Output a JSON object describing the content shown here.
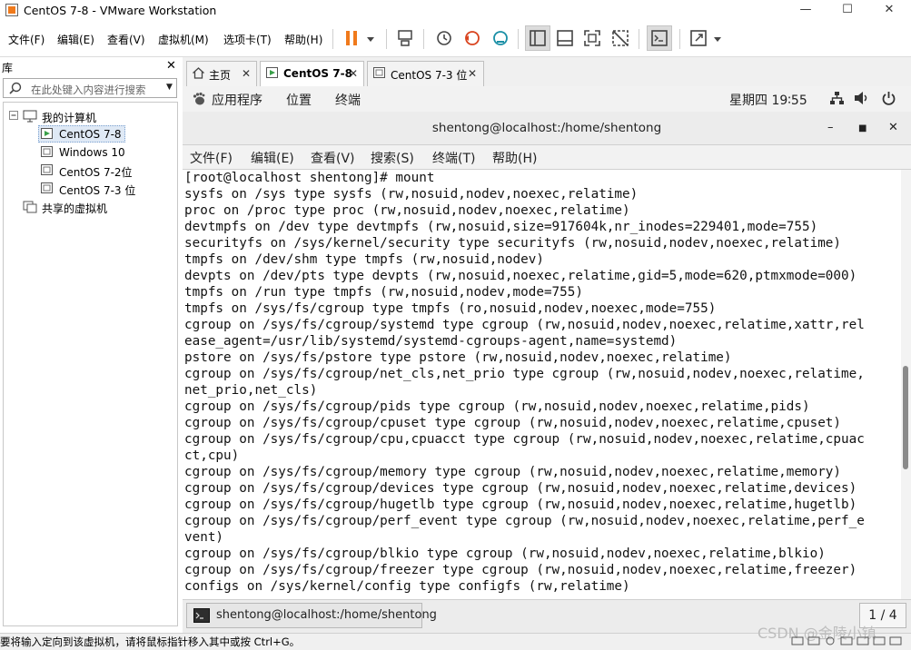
{
  "window": {
    "title": "CentOS 7-8 - VMware Workstation",
    "controls": [
      "—",
      "☐",
      "✕"
    ]
  },
  "menubar": {
    "items": [
      "文件(F)",
      "编辑(E)",
      "查看(V)",
      "虚拟机(M)",
      "选项卡(T)",
      "帮助(H)"
    ]
  },
  "library": {
    "title": "库",
    "close": "✕",
    "search_placeholder": "在此处键入内容进行搜索",
    "tree": {
      "root": "我的计算机",
      "vms": [
        "CentOS 7-8",
        "Windows 10",
        "CentOS 7-2位",
        "CentOS 7-3 位"
      ],
      "shared": "共享的虚拟机"
    }
  },
  "tabs": [
    {
      "label": "主页",
      "closable": true
    },
    {
      "label": "CentOS 7-8",
      "closable": true,
      "active": true
    },
    {
      "label": "CentOS 7-3 位",
      "closable": true
    }
  ],
  "gnome": {
    "applications": "应用程序",
    "places": "位置",
    "terminal": "终端",
    "clock": "星期四 19∶55"
  },
  "terminal": {
    "title": "shentong@localhost:/home/shentong",
    "menu": [
      "文件(F)",
      "编辑(E)",
      "查看(V)",
      "搜索(S)",
      "终端(T)",
      "帮助(H)"
    ],
    "lines": [
      "[root@localhost shentong]# mount",
      "sysfs on /sys type sysfs (rw,nosuid,nodev,noexec,relatime)",
      "proc on /proc type proc (rw,nosuid,nodev,noexec,relatime)",
      "devtmpfs on /dev type devtmpfs (rw,nosuid,size=917604k,nr_inodes=229401,mode=755)",
      "securityfs on /sys/kernel/security type securityfs (rw,nosuid,nodev,noexec,relatime)",
      "tmpfs on /dev/shm type tmpfs (rw,nosuid,nodev)",
      "devpts on /dev/pts type devpts (rw,nosuid,noexec,relatime,gid=5,mode=620,ptmxmode=000)",
      "tmpfs on /run type tmpfs (rw,nosuid,nodev,mode=755)",
      "tmpfs on /sys/fs/cgroup type tmpfs (ro,nosuid,nodev,noexec,mode=755)",
      "cgroup on /sys/fs/cgroup/systemd type cgroup (rw,nosuid,nodev,noexec,relatime,xattr,rel",
      "ease_agent=/usr/lib/systemd/systemd-cgroups-agent,name=systemd)",
      "pstore on /sys/fs/pstore type pstore (rw,nosuid,nodev,noexec,relatime)",
      "cgroup on /sys/fs/cgroup/net_cls,net_prio type cgroup (rw,nosuid,nodev,noexec,relatime,",
      "net_prio,net_cls)",
      "cgroup on /sys/fs/cgroup/pids type cgroup (rw,nosuid,nodev,noexec,relatime,pids)",
      "cgroup on /sys/fs/cgroup/cpuset type cgroup (rw,nosuid,nodev,noexec,relatime,cpuset)",
      "cgroup on /sys/fs/cgroup/cpu,cpuacct type cgroup (rw,nosuid,nodev,noexec,relatime,cpuac",
      "ct,cpu)",
      "cgroup on /sys/fs/cgroup/memory type cgroup (rw,nosuid,nodev,noexec,relatime,memory)",
      "cgroup on /sys/fs/cgroup/devices type cgroup (rw,nosuid,nodev,noexec,relatime,devices)",
      "cgroup on /sys/fs/cgroup/hugetlb type cgroup (rw,nosuid,nodev,noexec,relatime,hugetlb)",
      "cgroup on /sys/fs/cgroup/perf_event type cgroup (rw,nosuid,nodev,noexec,relatime,perf_e",
      "vent)",
      "cgroup on /sys/fs/cgroup/blkio type cgroup (rw,nosuid,nodev,noexec,relatime,blkio)",
      "cgroup on /sys/fs/cgroup/freezer type cgroup (rw,nosuid,nodev,noexec,relatime,freezer)",
      "configs on /sys/kernel/config type configfs (rw,relatime)"
    ]
  },
  "taskbar": {
    "window_label": "shentong@localhost:/home/shentong",
    "pager": "1 / 4"
  },
  "statusbar": {
    "text": "要将输入定向到该虚拟机，请将鼠标指针移入其中或按 Ctrl+G。"
  },
  "watermark": "CSDN @金陵小镇",
  "colors": {
    "pause_accent": "#f07a1c",
    "toolbar_icon": "#4a4a4a",
    "vm_icon_green": "#3aa04a"
  }
}
